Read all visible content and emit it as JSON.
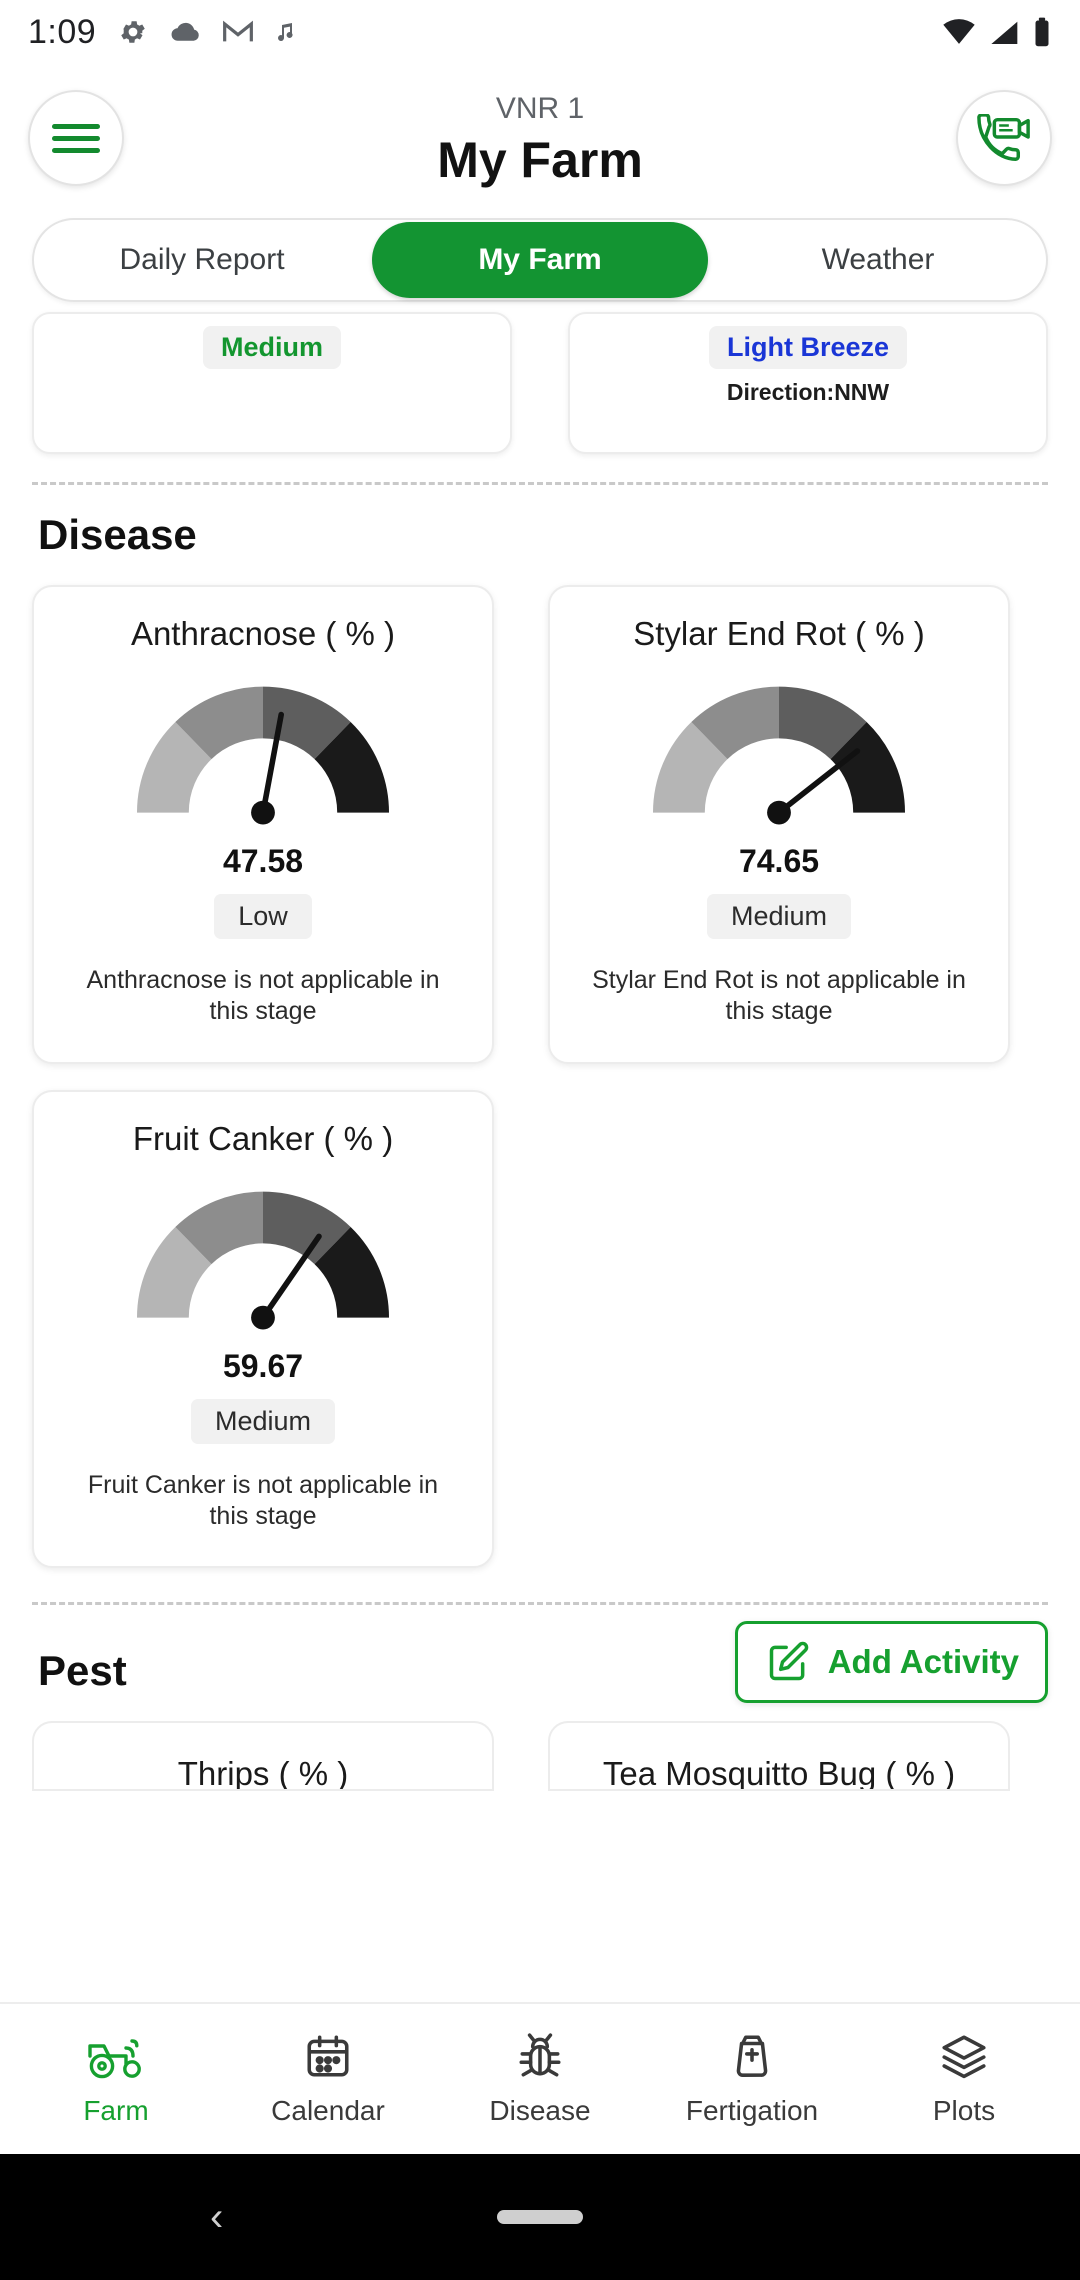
{
  "statusbar": {
    "time": "1:09",
    "left_icons": [
      "gear-icon",
      "cloud-icon",
      "gmail-icon",
      "music-note-icon"
    ],
    "right_icons": [
      "wifi-icon",
      "signal-icon",
      "battery-icon"
    ]
  },
  "header": {
    "menu_icon": "hamburger-menu-icon",
    "plot_name": "VNR 1",
    "title": "My Farm",
    "call_icon": "video-call-icon"
  },
  "tabs": [
    {
      "label": "Daily Report",
      "active": false
    },
    {
      "label": "My Farm",
      "active": true
    },
    {
      "label": "Weather",
      "active": false
    }
  ],
  "weather_cards": [
    {
      "value": "Medium",
      "value_color": "#13962f",
      "direction": ""
    },
    {
      "value": "Light Breeze",
      "value_color": "#1a36d6",
      "direction": "Direction:NNW"
    }
  ],
  "disease": {
    "section_title": "Disease",
    "cards": [
      {
        "title": "Anthracnose ( % )",
        "value": "47.58",
        "badge": "Low",
        "note": "Anthracnose is not applicable in this stage",
        "needle_deg": 8
      },
      {
        "title": "Stylar End Rot ( % )",
        "value": "74.65",
        "badge": "Medium",
        "note": "Stylar End Rot is not applicable in this stage",
        "needle_deg": 52
      },
      {
        "title": "Fruit Canker ( % )",
        "value": "59.67",
        "badge": "Medium",
        "note": "Fruit Canker is not applicable in this stage",
        "needle_deg": 34
      }
    ],
    "gauge_colors": [
      "#b5b5b5",
      "#8d8d8d",
      "#5e5e5e",
      "#1a1a1a"
    ]
  },
  "pest": {
    "section_title": "Pest",
    "add_activity_label": "Add Activity",
    "add_activity_icon": "edit-square-icon",
    "cards": [
      {
        "title": "Thrips ( % )"
      },
      {
        "title": "Tea Mosquitto Bug ( % )"
      }
    ]
  },
  "bottom_nav": [
    {
      "label": "Farm",
      "icon": "tractor-icon",
      "active": true
    },
    {
      "label": "Calendar",
      "icon": "calendar-icon",
      "active": false
    },
    {
      "label": "Disease",
      "icon": "bug-icon",
      "active": false
    },
    {
      "label": "Fertigation",
      "icon": "fertilizer-bag-icon",
      "active": false
    },
    {
      "label": "Plots",
      "icon": "layers-icon",
      "active": false
    }
  ],
  "system_nav": {
    "back_icon": "back-chevron-icon",
    "home_pill": "home-pill"
  },
  "colors": {
    "brand_green": "#139432",
    "accent_blue": "#1a36d6"
  }
}
